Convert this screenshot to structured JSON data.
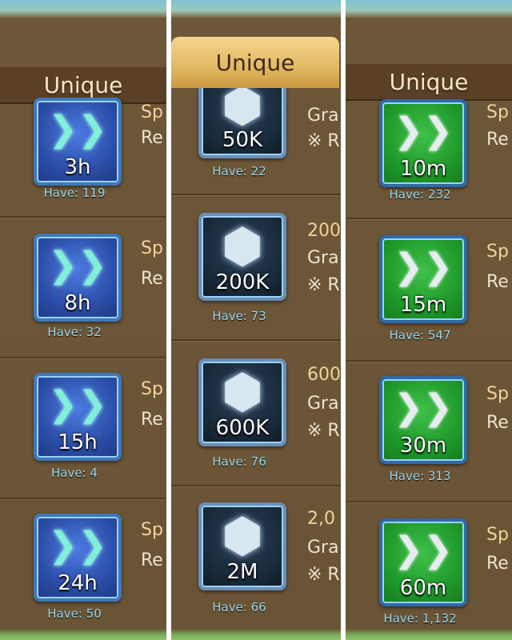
{
  "colors": {
    "panel_bg": "#6d5738",
    "tab_text": "#f5e6c4",
    "have_text": "#9ed6e8",
    "title_gold": "#f0d39a"
  },
  "left": {
    "tab_label": "Unique",
    "items": [
      {
        "icon": "speedup-arrows-icon",
        "label": "3h",
        "have": "Have: 119",
        "line1": "Sp",
        "line2": "Re"
      },
      {
        "icon": "speedup-arrows-icon",
        "label": "8h",
        "have": "Have: 32",
        "line1": "Sp",
        "line2": "Re"
      },
      {
        "icon": "speedup-arrows-icon",
        "label": "15h",
        "have": "Have: 4",
        "line1": "Sp",
        "line2": "Re"
      },
      {
        "icon": "speedup-arrows-icon",
        "label": "24h",
        "have": "Have: 50",
        "line1": "Sp",
        "line2": "Re"
      }
    ]
  },
  "middle": {
    "tab_label": "Unique",
    "items": [
      {
        "icon": "crystal-gem-icon",
        "label": "50K",
        "have": "Have: 22",
        "line1": "",
        "line2": "Gra",
        "line3": "※ R"
      },
      {
        "icon": "crystal-gem-icon",
        "label": "200K",
        "have": "Have: 73",
        "line1": "200",
        "line2": "Gra",
        "line3": "※ R"
      },
      {
        "icon": "crystal-gem-icon",
        "label": "600K",
        "have": "Have: 76",
        "line1": "600",
        "line2": "Gra",
        "line3": "※ R"
      },
      {
        "icon": "crystal-gem-icon",
        "label": "2M",
        "have": "Have: 66",
        "line1": "2,0",
        "line2": "Gra",
        "line3": "※ R"
      }
    ]
  },
  "right": {
    "tab_label": "Unique",
    "items": [
      {
        "icon": "silver-arrows-icon",
        "label": "10m",
        "have": "Have: 232",
        "line1": "Sp",
        "line2": "Re"
      },
      {
        "icon": "silver-arrows-icon",
        "label": "15m",
        "have": "Have: 547",
        "line1": "Sp",
        "line2": "Re"
      },
      {
        "icon": "silver-arrows-icon",
        "label": "30m",
        "have": "Have: 313",
        "line1": "Sp",
        "line2": "Re"
      },
      {
        "icon": "silver-arrows-icon",
        "label": "60m",
        "have": "Have: 1,132",
        "line1": "Sp",
        "line2": "Re"
      }
    ]
  }
}
